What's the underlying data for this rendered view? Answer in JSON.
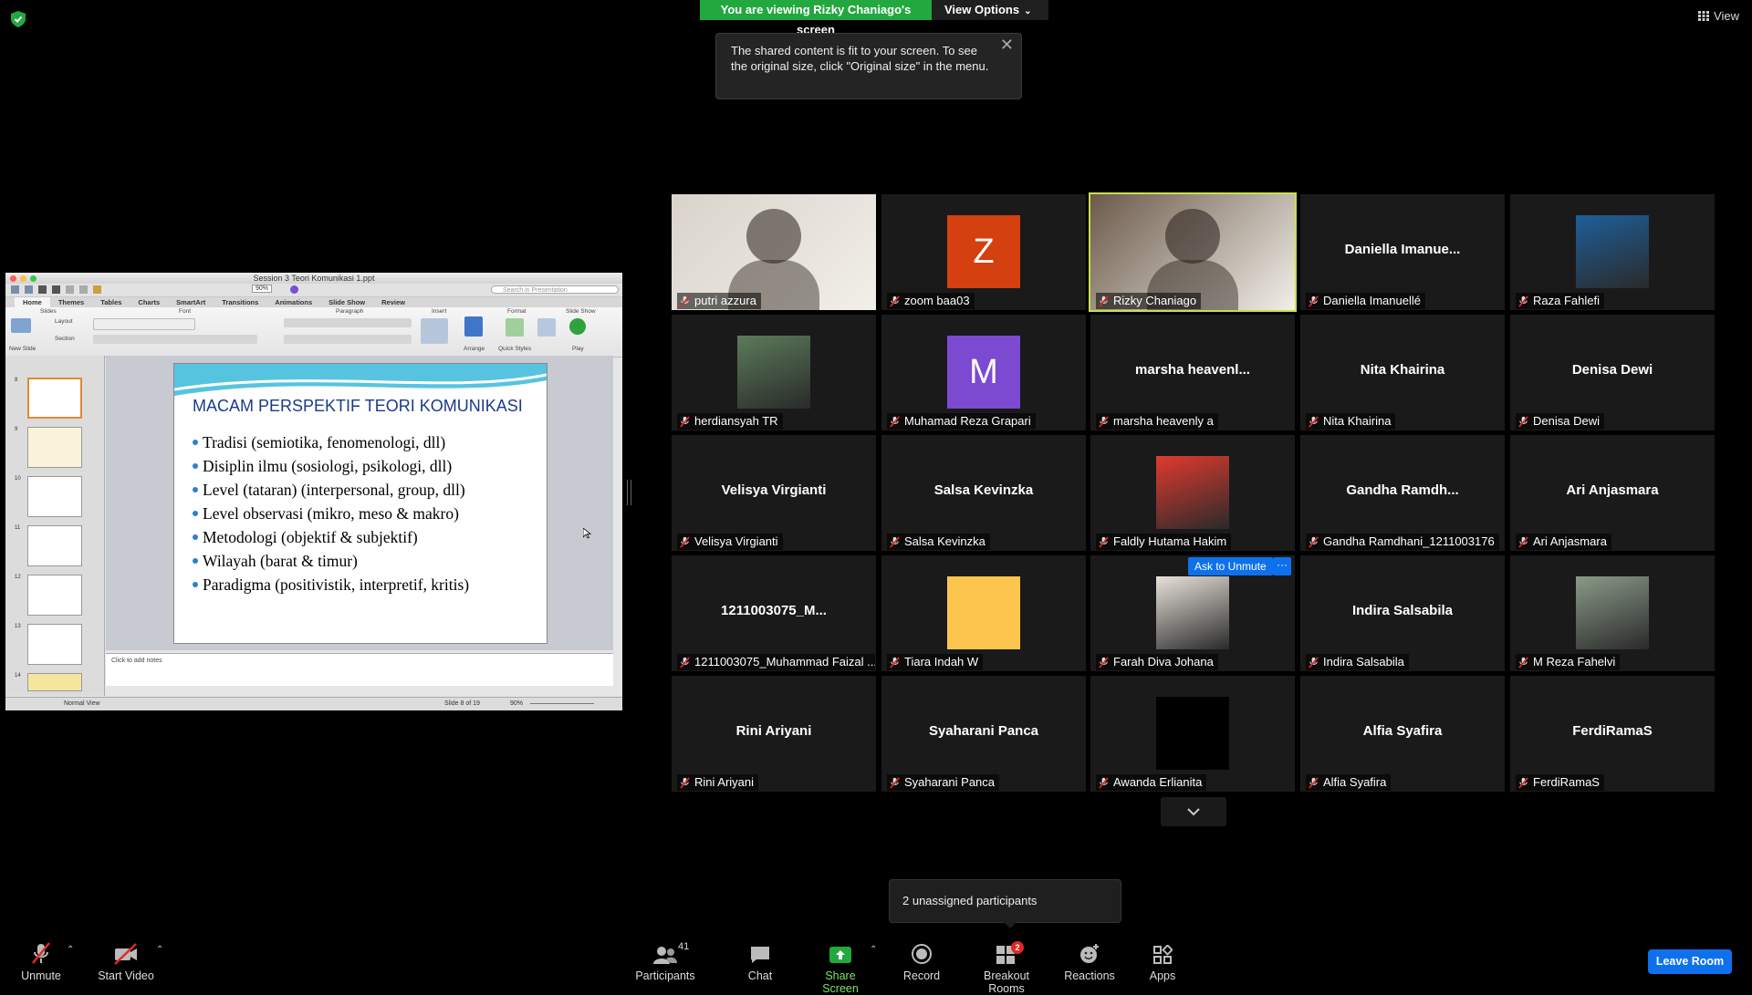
{
  "banner": {
    "viewing": "You are viewing Rizky Chaniago's screen",
    "view_options": "View Options"
  },
  "top_right": {
    "view_label": "View"
  },
  "tooltip": {
    "text": "The shared content is fit to your screen. To see the original size, click \"Original size\" in the menu."
  },
  "shared_screen": {
    "window_title": "Session 3 Teori Komunikasi 1.ppt",
    "search_placeholder": "Search in Presentation",
    "zoom": "90%",
    "tabs": [
      "Home",
      "Themes",
      "Tables",
      "Charts",
      "SmartArt",
      "Transitions",
      "Animations",
      "Slide Show",
      "Review"
    ],
    "ribbon_groups": [
      "Slides",
      "Font",
      "Paragraph",
      "Insert",
      "Format",
      "Slide Show"
    ],
    "ribbon_buttons": {
      "new_slide": "New Slide",
      "layout": "Layout",
      "section": "Section",
      "arrange": "Arrange",
      "quick_styles": "Quick Styles",
      "play": "Play"
    },
    "slide_numbers": [
      "8",
      "9",
      "10",
      "11",
      "12",
      "13",
      "14"
    ],
    "slide": {
      "title": "MACAM PERSPEKTIF TEORI KOMUNIKASI",
      "bullets": [
        "Tradisi (semiotika, fenomenologi, dll)",
        "Disiplin ilmu (sosiologi, psikologi, dll)",
        "Level (tataran) (interpersonal, group, dll)",
        "Level observasi (mikro, meso & makro)",
        "Metodologi (objektif & subjektif)",
        "Wilayah (barat & timur)",
        "Paradigma (positivistik, interpretif, kritis)"
      ]
    },
    "notes_placeholder": "Click to add notes",
    "status": {
      "view": "Normal View",
      "slide_of": "Slide 8 of 19",
      "zoom": "90%"
    }
  },
  "participants": [
    {
      "name": "putri azzura",
      "display": "video",
      "color": "#d9d3cb"
    },
    {
      "name": "zoom baa03",
      "display": "letter",
      "letter": "Z",
      "color": "#d4400f"
    },
    {
      "name": "Rizky Chaniago",
      "display": "video",
      "active": true,
      "color": "#6b5a4a"
    },
    {
      "name": "Daniella Imanuellé",
      "display": "name",
      "big": "Daniella  Imanue..."
    },
    {
      "name": "Raza Fahlefi",
      "display": "pic",
      "color": "#1d5f9a"
    },
    {
      "name": "herdiansyah TR",
      "display": "pic",
      "color": "#5b7b5a"
    },
    {
      "name": "Muhamad Reza Grapari",
      "display": "letter",
      "letter": "M",
      "color": "#7b4ad1"
    },
    {
      "name": "marsha heavenly a",
      "display": "name",
      "big": "marsha  heavenl..."
    },
    {
      "name": "Nita Khairina",
      "display": "name",
      "big": "Nita Khairina"
    },
    {
      "name": "Denisa Dewi",
      "display": "name",
      "big": "Denisa Dewi"
    },
    {
      "name": "Velisya Virgianti",
      "display": "name",
      "big": "Velisya Virgianti"
    },
    {
      "name": "Salsa Kevinzka",
      "display": "name",
      "big": "Salsa Kevinzka"
    },
    {
      "name": "Faldly Hutama Hakim",
      "display": "pic",
      "color": "#e03a2e"
    },
    {
      "name": "Gandha Ramdhani_1211003176",
      "display": "name",
      "big": "Gandha  Ramdh..."
    },
    {
      "name": "Ari Anjasmara",
      "display": "name",
      "big": "Ari Anjasmara"
    },
    {
      "name": "1211003075_Muhammad Faizal ...",
      "display": "name",
      "big": "1211003075_M..."
    },
    {
      "name": "Tiara Indah W",
      "display": "letter",
      "letter": "",
      "color": "#fcc64e"
    },
    {
      "name": "Farah Diva Johana",
      "display": "pic",
      "color": "#e8e2da"
    },
    {
      "name": "Indira Salsabila",
      "display": "name",
      "big": "Indira Salsabila"
    },
    {
      "name": "M Reza Fahelvi",
      "display": "pic",
      "color": "#8a9a88"
    },
    {
      "name": "Rini Ariyani",
      "display": "name",
      "big": "Rini Ariyani"
    },
    {
      "name": "Syaharani Panca",
      "display": "name",
      "big": "Syaharani Panca"
    },
    {
      "name": "Awanda Erlianita",
      "display": "letter",
      "letter": "",
      "color": "#000000"
    },
    {
      "name": "Alfia Syafira",
      "display": "name",
      "big": "Alfia Syafira"
    },
    {
      "name": "FerdiRamaS",
      "display": "name",
      "big": "FerdiRamaS"
    }
  ],
  "hover_actions": {
    "ask_to_unmute": "Ask to Unmute",
    "more": "···"
  },
  "unassigned": "2 unassigned participants",
  "toolbar": {
    "unmute": "Unmute",
    "start_video": "Start Video",
    "participants": "Participants",
    "participants_count": "41",
    "chat": "Chat",
    "share_screen": "Share Screen",
    "record": "Record",
    "breakout_rooms": "Breakout Rooms",
    "breakout_badge": "2",
    "reactions": "Reactions",
    "apps": "Apps",
    "leave": "Leave Room"
  },
  "colors": {
    "accent_green": "#23a83f",
    "accent_blue": "#0e71eb",
    "active_speaker": "#c8e04a",
    "muted_red": "#e02828"
  }
}
